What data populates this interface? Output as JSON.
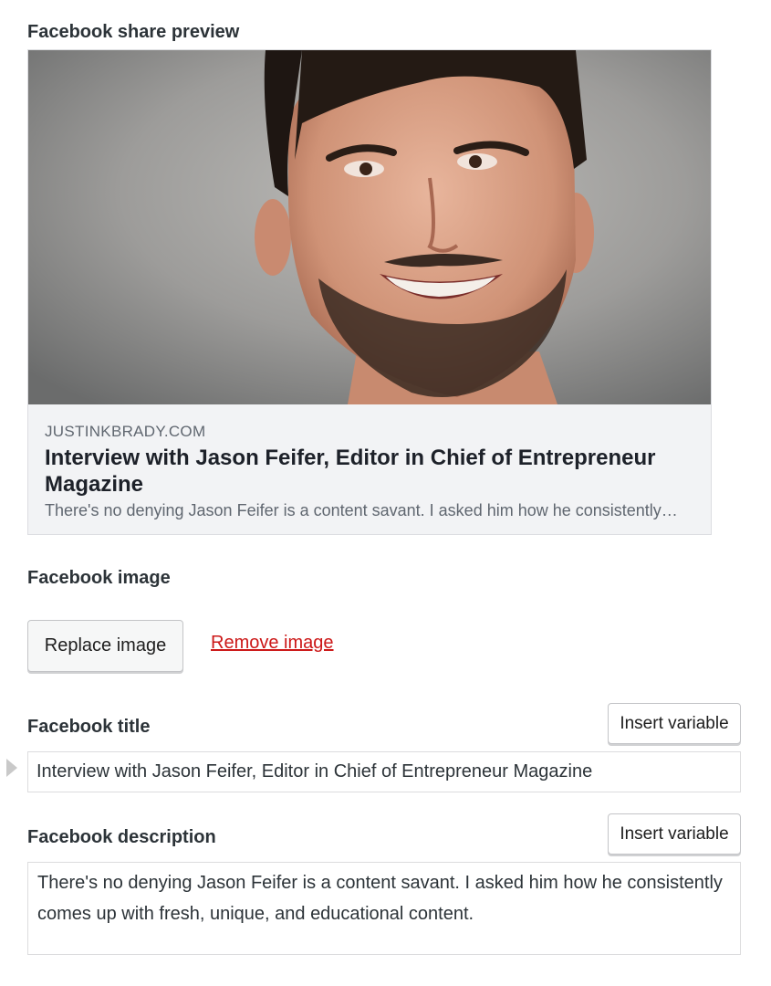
{
  "preview": {
    "section_label": "Facebook share preview",
    "domain": "JUSTINKBRADY.COM",
    "title": "Interview with Jason Feifer, Editor in Chief of Entrepreneur Magazine",
    "description": "There's no denying Jason Feifer is a content savant. I asked him how he consistently…"
  },
  "image_section": {
    "label": "Facebook image",
    "replace_label": "Replace image",
    "remove_label": "Remove image"
  },
  "title_field": {
    "label": "Facebook title",
    "insert_variable_label": "Insert variable",
    "value": "Interview with Jason Feifer, Editor in Chief of Entrepreneur Magazine"
  },
  "description_field": {
    "label": "Facebook description",
    "insert_variable_label": "Insert variable",
    "value": "There's no denying Jason Feifer is a content savant. I asked him how he consistently comes up with fresh, unique, and educational content."
  },
  "colors": {
    "remove_link": "#cc1818",
    "preview_background": "#f2f3f5"
  }
}
